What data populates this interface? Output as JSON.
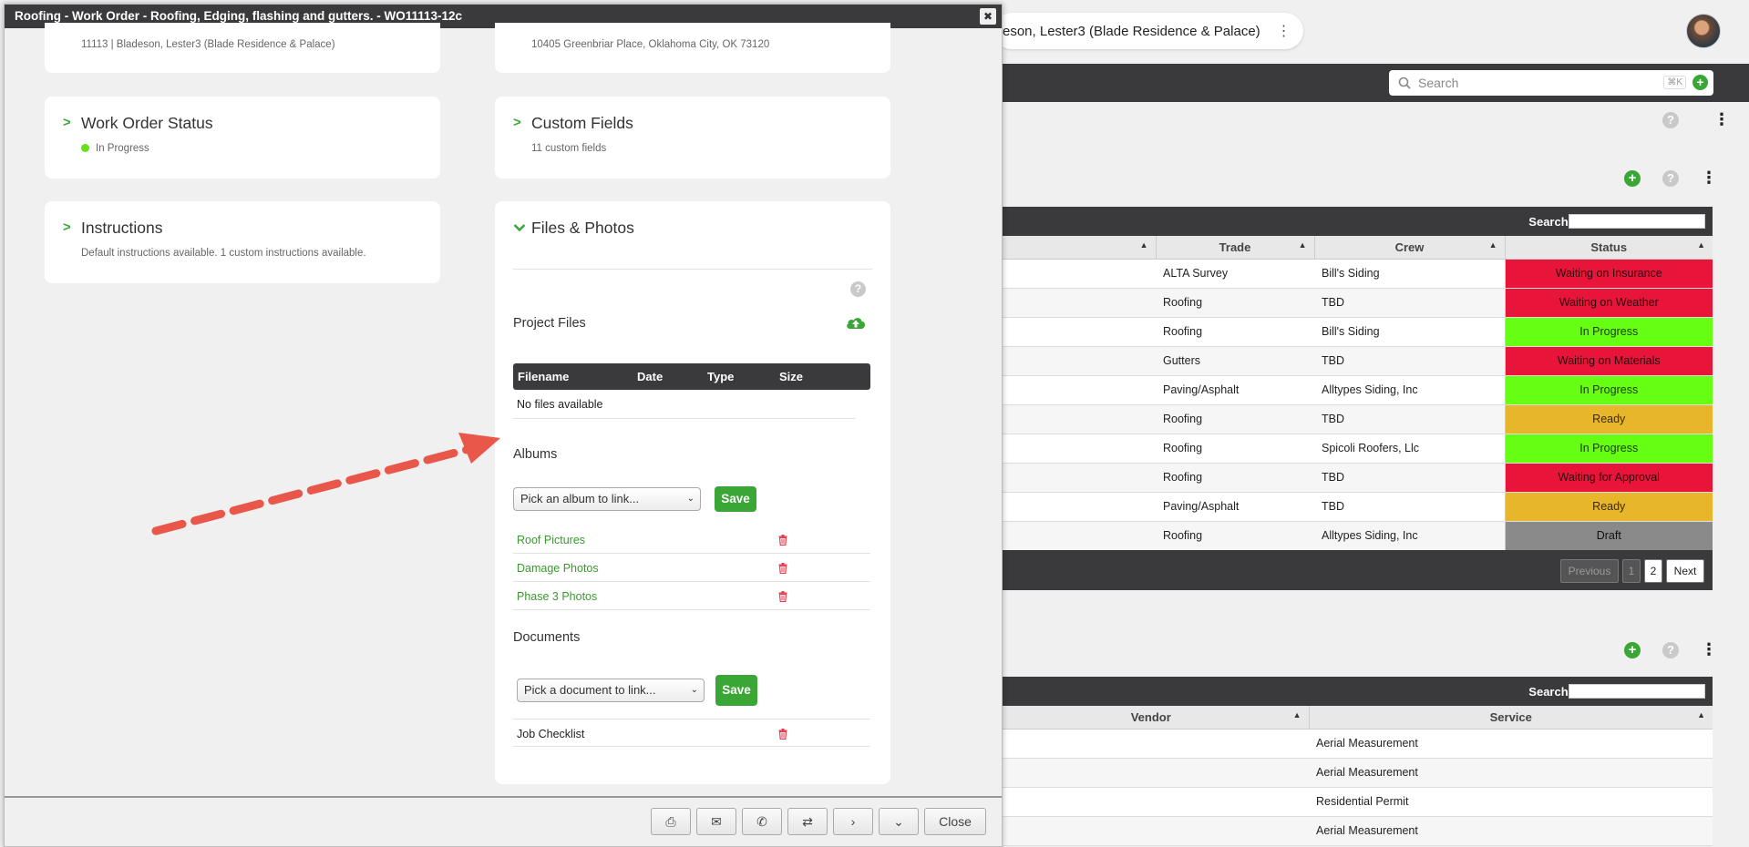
{
  "modal": {
    "title": "Roofing - Work Order - Roofing, Edging, flashing and gutters. - WO11113-12c",
    "close_x": "✖",
    "top_left_sub": "11113 | Bladeson, Lester3 (Blade Residence & Palace)",
    "top_right_sub": "10405 Greenbriar Place, Oklahoma City, OK 73120",
    "cards": {
      "work_order_status": {
        "title": "Work Order Status",
        "value": "In Progress"
      },
      "custom_fields": {
        "title": "Custom Fields",
        "value": "11 custom fields"
      },
      "instructions": {
        "title": "Instructions",
        "value": "Default instructions available. 1 custom instructions available."
      }
    },
    "files": {
      "title": "Files & Photos",
      "project_files_title": "Project Files",
      "columns": [
        "Filename",
        "Date",
        "Type",
        "Size"
      ],
      "empty_text": "No files available",
      "albums_title": "Albums",
      "album_placeholder": "Pick an album to link...",
      "save_label": "Save",
      "albums": [
        "Roof Pictures",
        "Damage Photos",
        "Phase 3 Photos"
      ],
      "documents_title": "Documents",
      "document_placeholder": "Pick a document to link...",
      "documents": [
        "Job Checklist"
      ]
    },
    "footer": {
      "print": "⎙",
      "email": "✉",
      "phone": "✆",
      "transfer": "⇄",
      "next": "›",
      "more": "⌄",
      "close_label": "Close"
    }
  },
  "background": {
    "breadcrumb": "eson, Lester3 (Blade Residence & Palace)",
    "search_placeholder": "Search",
    "search_shortcut": "⌘K",
    "table1": {
      "search_label": "Search:",
      "columns": [
        "Trade",
        "Crew",
        "Status"
      ],
      "rows": [
        [
          "ALTA Survey",
          "Bill's Siding",
          "Waiting on Insurance",
          "red"
        ],
        [
          "Roofing",
          "TBD",
          "Waiting on Weather",
          "red"
        ],
        [
          "Roofing",
          "Bill's Siding",
          "In Progress",
          "green"
        ],
        [
          "Gutters",
          "TBD",
          "Waiting on Materials",
          "red"
        ],
        [
          "Paving/Asphalt",
          "Alltypes Siding, Inc",
          "In Progress",
          "green"
        ],
        [
          "Roofing",
          "TBD",
          "Ready",
          "yellow"
        ],
        [
          "Roofing",
          "Spicoli Roofers, Llc",
          "In Progress",
          "green"
        ],
        [
          "Roofing",
          "TBD",
          "Waiting for Approval",
          "red"
        ],
        [
          "Paving/Asphalt",
          "TBD",
          "Ready",
          "yellow"
        ],
        [
          "Roofing",
          "Alltypes Siding, Inc",
          "Draft",
          "gray"
        ]
      ],
      "pager": {
        "previous": "Previous",
        "page1": "1",
        "page2": "2",
        "next": "Next"
      }
    },
    "table2": {
      "search_label": "Search:",
      "columns": [
        "Vendor",
        "Service"
      ],
      "rows": [
        "Aerial Measurement",
        "Aerial Measurement",
        "Residential Permit",
        "Aerial Measurement"
      ]
    }
  },
  "colors": {
    "accent_green": "#3aa635",
    "dark_bar": "#3a3a3c",
    "status_red": "#e8143a",
    "status_green": "#66ff14",
    "status_yellow": "#e8b62a",
    "status_gray": "#8a8a8a",
    "arrow": "#e8574a"
  }
}
